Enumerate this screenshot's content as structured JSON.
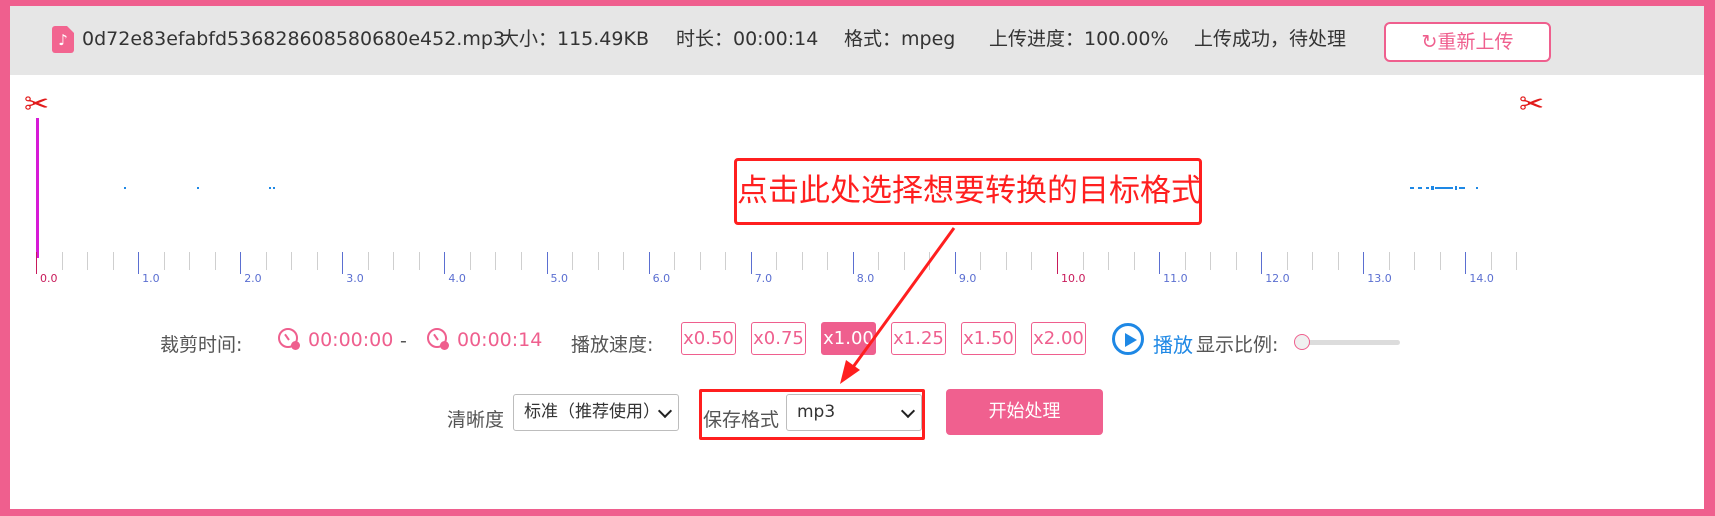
{
  "header": {
    "file_icon": "music-note-icon",
    "file_icon_glyph": "♪",
    "filename": "0d72e83efabfd536828608580680e452.mp3",
    "size": "大小：115.49KB",
    "duration": "时长：00:00:14",
    "format": "格式：mpeg",
    "progress": "上传进度：100.00%",
    "status": "上传成功，待处理",
    "reupload_label": "重新上传",
    "reupload_icon": "refresh-icon",
    "reupload_glyph": "↻"
  },
  "scissor_glyph": "✂",
  "timeline": {
    "labels": [
      "0.0",
      "1.0",
      "2.0",
      "3.0",
      "4.0",
      "5.0",
      "6.0",
      "7.0",
      "8.0",
      "9.0",
      "10.0",
      "11.0",
      "12.0",
      "13.0",
      "14.0"
    ]
  },
  "controls": {
    "trim_label": "裁剪时间:",
    "start_time": "00:00:00",
    "separator": "-",
    "end_time": "00:00:14",
    "speed_label": "播放速度:",
    "speeds": [
      "x0.50",
      "x0.75",
      "x1.00",
      "x1.25",
      "x1.50",
      "x2.00"
    ],
    "active_speed": "x1.00",
    "play_label": "播放",
    "zoom_label": "显示比例:",
    "zoom_level": 0
  },
  "output": {
    "quality_label": "清晰度",
    "quality_value": "标准（推荐使用）",
    "format_label": "保存格式",
    "format_value": "mp3",
    "start_label": "开始处理"
  },
  "annotation": {
    "text": "点击此处选择想要转换的目标格式"
  },
  "colors": {
    "accent": "#ef5f8e",
    "annotation": "#ff1f1f",
    "play": "#1e88e5",
    "tick_major": "#5b6fd1"
  }
}
